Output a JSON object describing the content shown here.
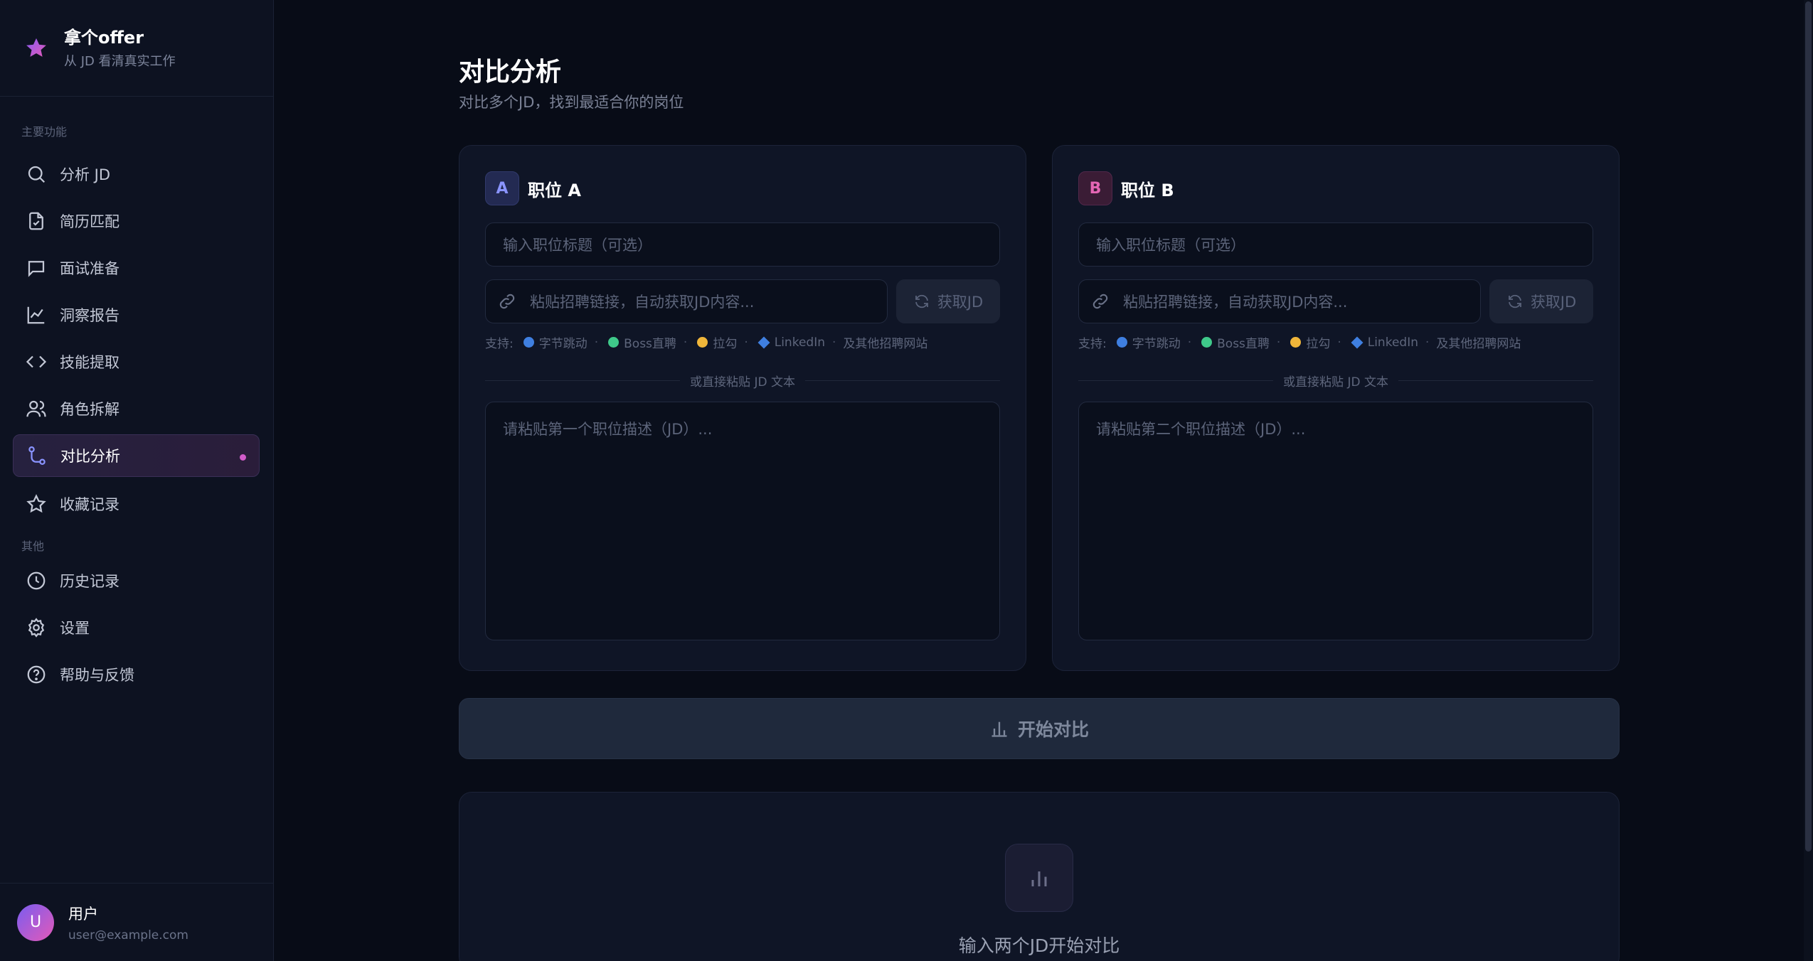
{
  "brand": {
    "title": "拿个offer",
    "subtitle": "从 JD 看清真实工作"
  },
  "sidebar": {
    "section_main": "主要功能",
    "section_other": "其他",
    "items": [
      {
        "label": "分析 JD",
        "icon": "search-icon"
      },
      {
        "label": "简历匹配",
        "icon": "document-check-icon"
      },
      {
        "label": "面试准备",
        "icon": "chat-icon"
      },
      {
        "label": "洞察报告",
        "icon": "line-chart-icon"
      },
      {
        "label": "技能提取",
        "icon": "code-icon"
      },
      {
        "label": "角色拆解",
        "icon": "users-icon"
      },
      {
        "label": "对比分析",
        "icon": "git-branch-icon",
        "active": true
      },
      {
        "label": "收藏记录",
        "icon": "star-icon"
      }
    ],
    "other_items": [
      {
        "label": "历史记录",
        "icon": "clock-icon"
      },
      {
        "label": "设置",
        "icon": "gear-icon"
      },
      {
        "label": "帮助与反馈",
        "icon": "help-circle-icon"
      }
    ]
  },
  "user": {
    "initial": "U",
    "name": "用户",
    "email": "user@example.com"
  },
  "main": {
    "title": "对比分析",
    "subtitle": "对比多个JD，找到最适合你的岗位",
    "cards": [
      {
        "badge": "A",
        "title": "职位 A",
        "title_placeholder": "输入职位标题（可选）",
        "url_placeholder": "粘贴招聘链接，自动获取JD内容...",
        "fetch_label": "获取JD",
        "divider": "或直接粘贴 JD 文本",
        "jd_placeholder": "请粘贴第一个职位描述（JD）..."
      },
      {
        "badge": "B",
        "title": "职位 B",
        "title_placeholder": "输入职位标题（可选）",
        "url_placeholder": "粘贴招聘链接，自动获取JD内容...",
        "fetch_label": "获取JD",
        "divider": "或直接粘贴 JD 文本",
        "jd_placeholder": "请粘贴第二个职位描述（JD）..."
      }
    ],
    "support": {
      "label": "支持:",
      "sites": [
        "字节跳动",
        "Boss直聘",
        "拉勾",
        "LinkedIn"
      ],
      "more": "及其他招聘网站",
      "colors": [
        "#3f7fe0",
        "#3fc98a",
        "#f0b63a",
        "#3f7fe0"
      ]
    },
    "start_button": "开始对比",
    "empty_text": "输入两个JD开始对比"
  },
  "colors": {
    "accent": "#d15bc9",
    "badge_a": "#8a94ff",
    "badge_b": "#e466b4"
  }
}
